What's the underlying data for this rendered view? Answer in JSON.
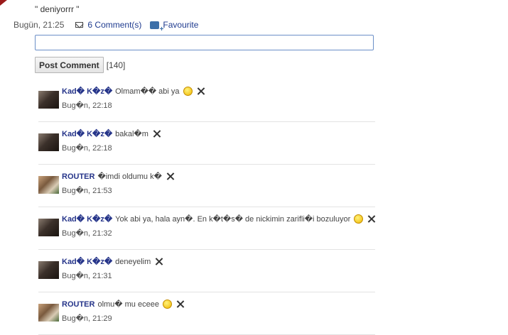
{
  "status": {
    "text": "\" deniyorrr \""
  },
  "meta": {
    "time": "Bugün, 21:25",
    "comments_link": "6 Comment(s)",
    "favourite_link": "Favourite"
  },
  "form": {
    "input_value": "",
    "post_button": "Post Comment",
    "char_count": "[140]"
  },
  "comments": [
    {
      "author": "Kad� K�z�",
      "text": "Olmam�� abi ya",
      "time": "Bug�n, 22:18",
      "emoji": true,
      "avatar": "dark"
    },
    {
      "author": "Kad� K�z�",
      "text": "bakal�m",
      "time": "Bug�n, 22:18",
      "emoji": false,
      "avatar": "dark"
    },
    {
      "author": "ROUTER",
      "text": "�imdi oldumu k�",
      "time": "Bug�n, 21:53",
      "emoji": false,
      "avatar": "router"
    },
    {
      "author": "Kad� K�z�",
      "text": "Yok abi ya, hala ayn�. En k�t�s� de nickimin zarifli�i bozuluyor",
      "time": "Bug�n, 21:32",
      "emoji": true,
      "avatar": "dark"
    },
    {
      "author": "Kad� K�z�",
      "text": "deneyelim",
      "time": "Bug�n, 21:31",
      "emoji": false,
      "avatar": "dark"
    },
    {
      "author": "ROUTER",
      "text": "olmu� mu eceee",
      "time": "Bug�n, 21:29",
      "emoji": true,
      "avatar": "router"
    }
  ],
  "colors": {
    "author": "#26358a",
    "link": "#1f3b8f",
    "input_border": "#6b8fc7"
  }
}
